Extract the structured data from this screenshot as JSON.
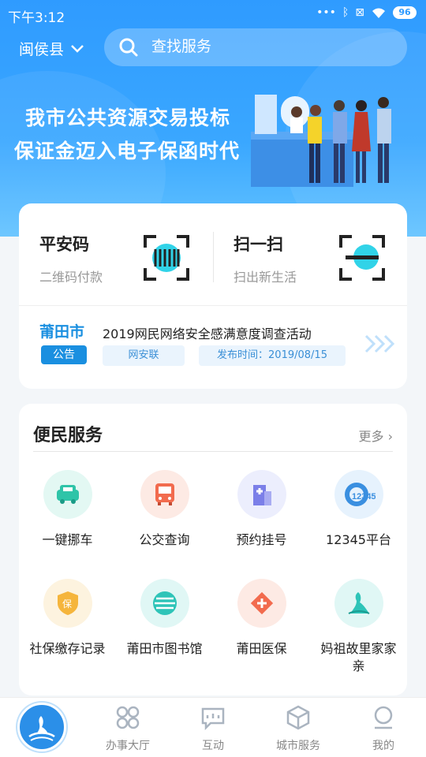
{
  "status_bar": {
    "time": "下午3:12",
    "battery": "96"
  },
  "header": {
    "region": "闽侯县",
    "search_placeholder": "查找服务"
  },
  "banner": {
    "line1": "我市公共资源交易投标",
    "line2": "保证金迈入电子保函时代"
  },
  "quick_actions": [
    {
      "title": "平安码",
      "subtitle": "二维码付款",
      "icon": "qr-barcode-icon"
    },
    {
      "title": "扫一扫",
      "subtitle": "扫出新生活",
      "icon": "scan-icon"
    }
  ],
  "notice": {
    "city_logo": "莆田市",
    "tag": "公告",
    "title": "2019网民网络安全感满意度调查活动",
    "source": "网安联",
    "published": "发布时间：2019/08/15"
  },
  "services": {
    "title": "便民服务",
    "more": "更多",
    "items": [
      {
        "label": "一键挪车",
        "icon": "car-icon",
        "color": "#2ec4a8"
      },
      {
        "label": "公交查询",
        "icon": "bus-icon",
        "color": "#f26b4e"
      },
      {
        "label": "预约挂号",
        "icon": "hospital-icon",
        "color": "#7b7fe8"
      },
      {
        "label": "12345平台",
        "icon": "hotline-12345-icon",
        "color": "#3a8fe0"
      },
      {
        "label": "社保缴存记录",
        "icon": "shield-icon",
        "color": "#f5b53c"
      },
      {
        "label": "莆田市图书馆",
        "icon": "library-icon",
        "color": "#2ec4b8"
      },
      {
        "label": "莆田医保",
        "icon": "medical-insurance-icon",
        "color": "#f26b4e"
      },
      {
        "label": "妈祖故里家家亲",
        "icon": "mazu-icon",
        "color": "#2ec4b8"
      }
    ]
  },
  "tabs": [
    {
      "label": "",
      "icon": "home-logo-icon"
    },
    {
      "label": "办事大厅",
      "icon": "grid-icon"
    },
    {
      "label": "互动",
      "icon": "chat-icon"
    },
    {
      "label": "城市服务",
      "icon": "cube-icon"
    },
    {
      "label": "我的",
      "icon": "user-icon"
    }
  ]
}
